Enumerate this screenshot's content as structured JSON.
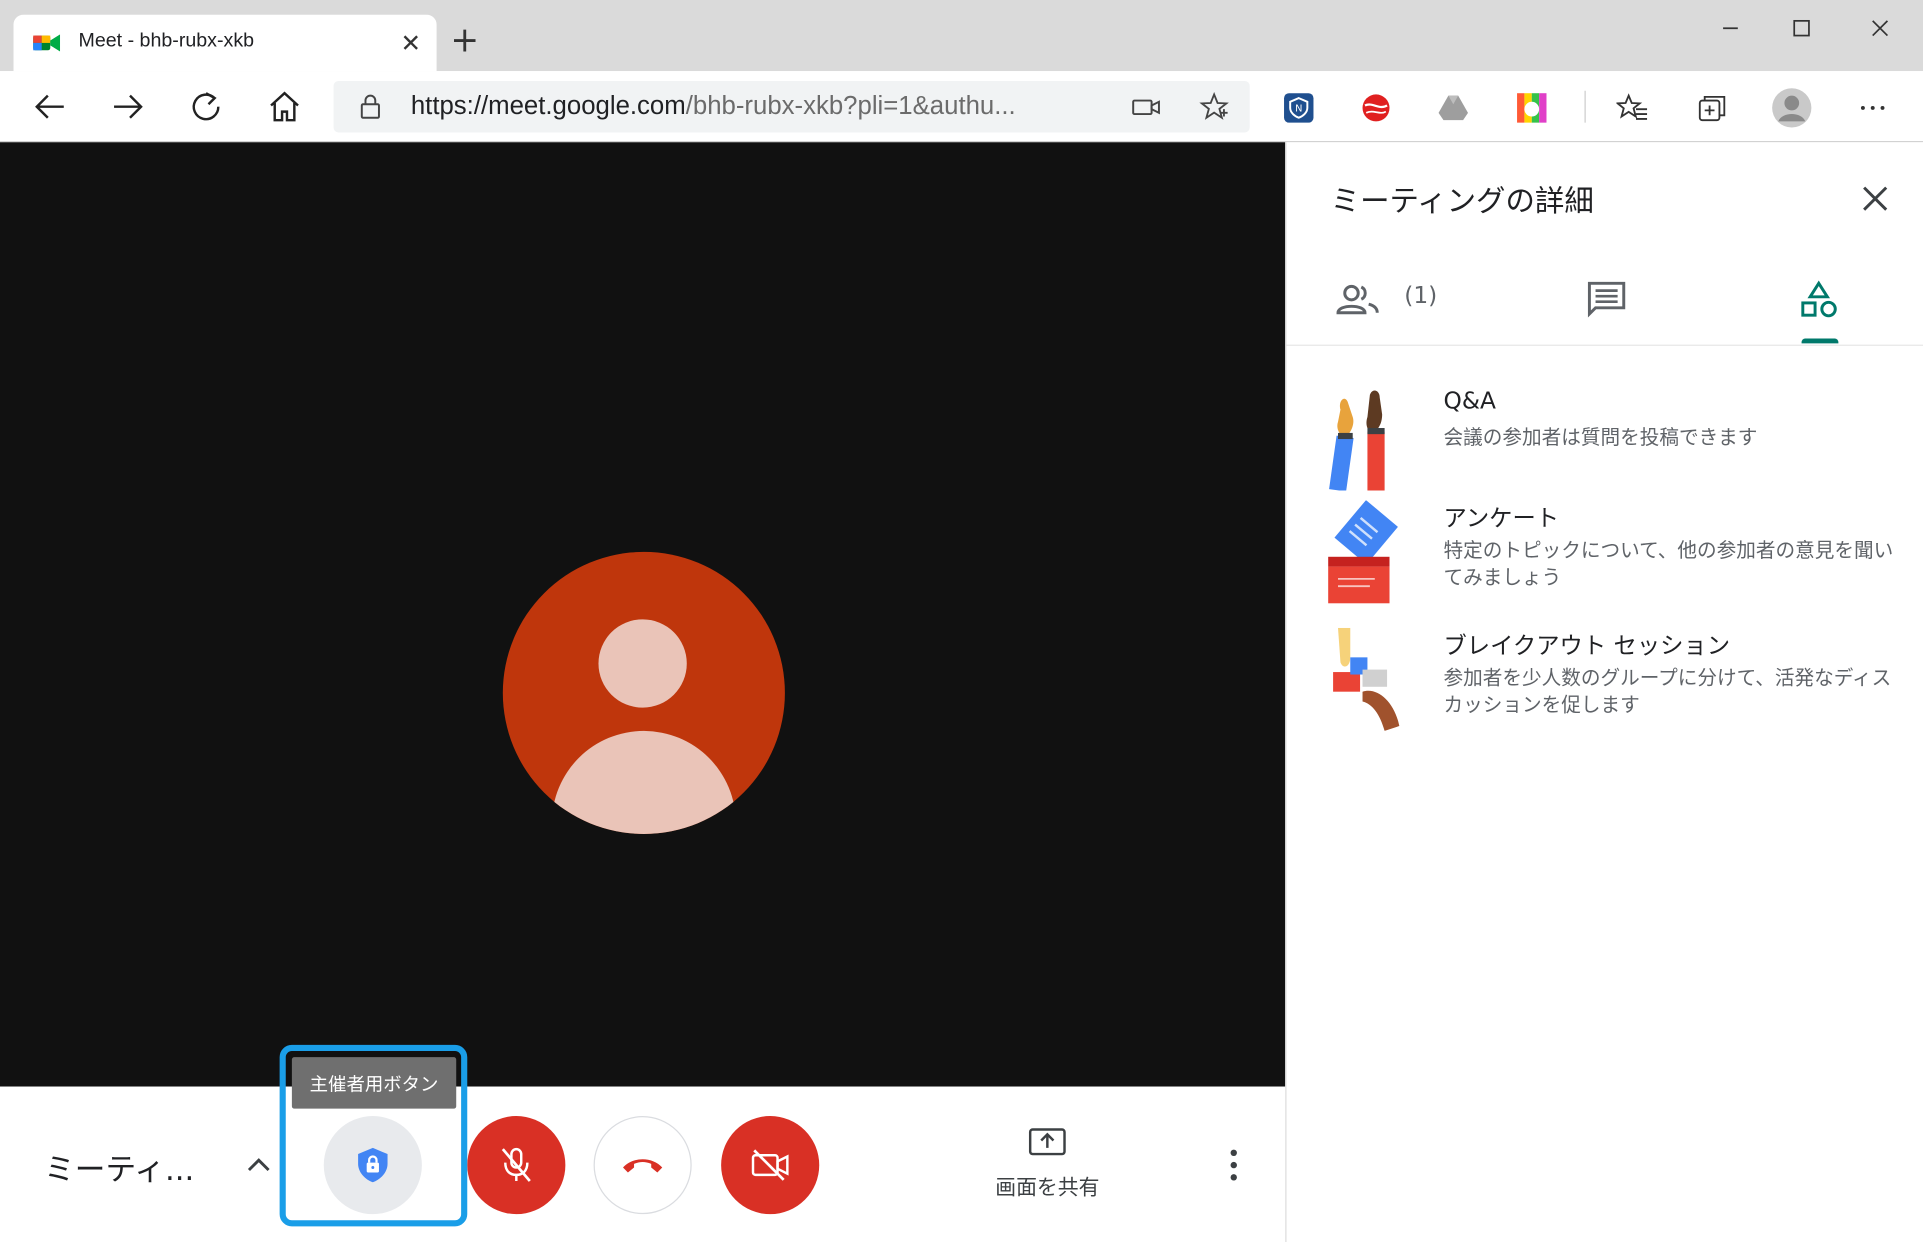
{
  "browser": {
    "tab_title": "Meet - bhb-rubx-xkb",
    "url_host": "https://meet.google.com",
    "url_rest": "/bhb-rubx-xkb?pli=1&authu..."
  },
  "meet": {
    "meeting_title": "ミーティ...",
    "tooltip": "主催者用ボタン",
    "share_label": "画面を共有"
  },
  "panel": {
    "title": "ミーティングの詳細",
    "people_count": "(1)",
    "activities": [
      {
        "name": "Q&A",
        "desc": "会議の参加者は質問を投稿できます"
      },
      {
        "name": "アンケート",
        "desc": "特定のトピックについて、他の参加者の意見を聞いてみましょう"
      },
      {
        "name": "ブレイクアウト セッション",
        "desc": "参加者を少人数のグループに分けて、活発なディスカッションを促します"
      }
    ]
  },
  "colors": {
    "stage_bg": "#111111",
    "avatar_bg": "#bf360c",
    "danger": "#d93025",
    "accent_teal": "#00796b",
    "highlight": "#1a9ee8"
  }
}
